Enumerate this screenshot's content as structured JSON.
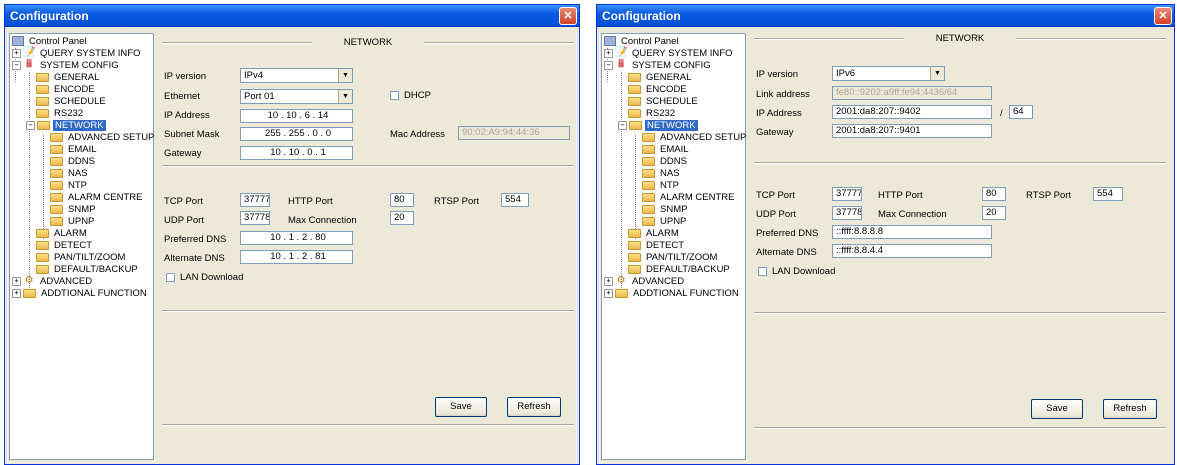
{
  "window_title": "Configuration",
  "close_glyph": "✕",
  "tree": {
    "control_panel": "Control Panel",
    "query_system_info": "QUERY SYSTEM INFO",
    "system_config": "SYSTEM CONFIG",
    "general": "GENERAL",
    "encode": "ENCODE",
    "schedule": "SCHEDULE",
    "rs232": "RS232",
    "network": "NETWORK",
    "advanced_setup": "ADVANCED SETUP",
    "email": "EMAIL",
    "ddns": "DDNS",
    "nas": "NAS",
    "ntp": "NTP",
    "alarm_centre": "ALARM CENTRE",
    "snmp": "SNMP",
    "upnp": "UPNP",
    "alarm": "ALARM",
    "detect": "DETECT",
    "ptz": "PAN/TILT/ZOOM",
    "default_backup": "DEFAULT/BACKUP",
    "advanced": "ADVANCED",
    "additional_function": "ADDTIONAL FUNCTION",
    "plus": "+",
    "minus": "−"
  },
  "left": {
    "section_title": "NETWORK",
    "ip_version_label": "IP version",
    "ip_version_value": "IPv4",
    "ethernet_label": "Ethernet",
    "ethernet_value": "Port 01",
    "dhcp_label": "DHCP",
    "ip_address_label": "IP Address",
    "ip_address_value": "10  .  10  .  6  .  14",
    "subnet_label": "Subnet Mask",
    "subnet_value": "255  .  255  .  0  .  0",
    "mac_label": "Mac Address",
    "mac_value": "90:02:A9:94:44:36",
    "gateway_label": "Gateway",
    "gateway_value": "10  .  10  .  0  .  1",
    "tcp_label": "TCP Port",
    "tcp_value": "37777",
    "http_label": "HTTP Port",
    "http_value": "80",
    "rtsp_label": "RTSP Port",
    "rtsp_value": "554",
    "udp_label": "UDP Port",
    "udp_value": "37778",
    "maxconn_label": "Max Connection",
    "maxconn_value": "20",
    "pdns_label": "Preferred DNS",
    "pdns_value": "10  .  1  .  2  .  80",
    "adns_label": "Alternate DNS",
    "adns_value": "10  .  1  .  2  .  81",
    "lan_label": "LAN Download",
    "save": "Save",
    "refresh": "Refresh"
  },
  "right": {
    "section_title": "NETWORK",
    "ip_version_label": "IP version",
    "ip_version_value": "IPv6",
    "link_label": "Link address",
    "link_value": "fe80::9202:a9ff:fe94:4436/64",
    "ip_address_label": "IP Address",
    "ip_address_value": "2001:da8:207::9402",
    "prefix_sep": "/",
    "prefix_value": "64",
    "gateway_label": "Gateway",
    "gateway_value": "2001:da8:207::9401",
    "tcp_label": "TCP Port",
    "tcp_value": "37777",
    "http_label": "HTTP Port",
    "http_value": "80",
    "rtsp_label": "RTSP Port",
    "rtsp_value": "554",
    "udp_label": "UDP Port",
    "udp_value": "37778",
    "maxconn_label": "Max Connection",
    "maxconn_value": "20",
    "pdns_label": "Preferred DNS",
    "pdns_value": "::ffff:8.8.8.8",
    "adns_label": "Alternate DNS",
    "adns_value": "::ffff:8.8.4.4",
    "lan_label": "LAN Download",
    "save": "Save",
    "refresh": "Refresh"
  }
}
